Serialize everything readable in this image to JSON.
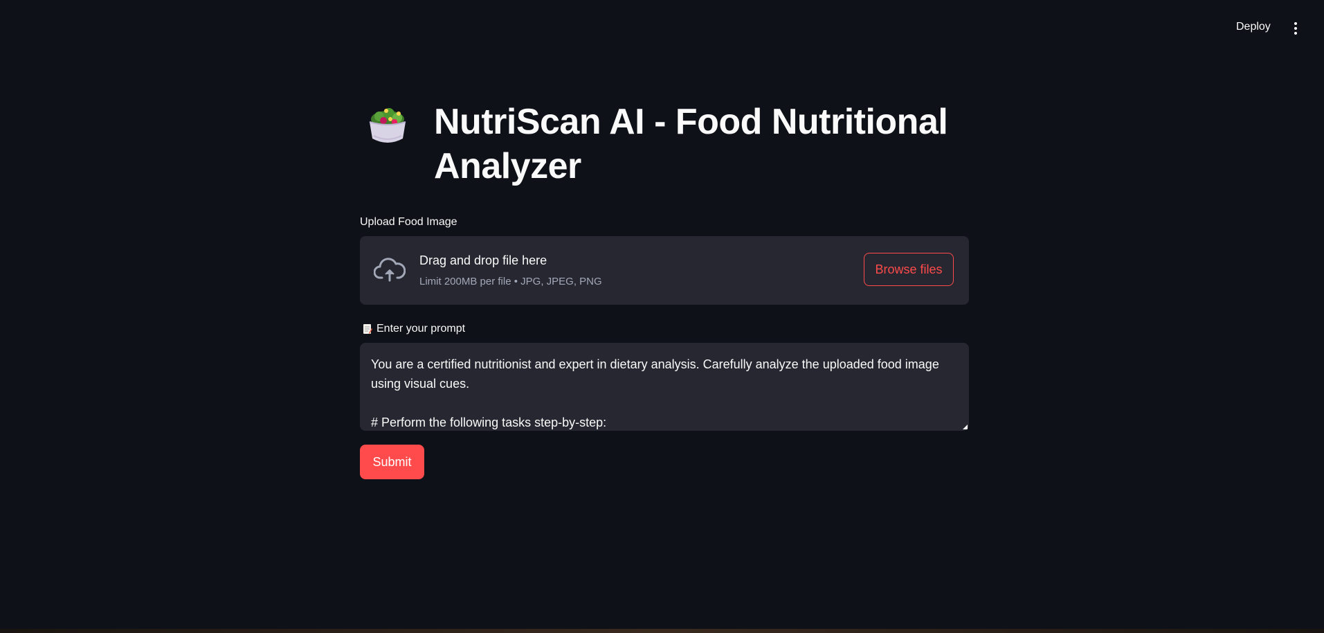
{
  "header": {
    "deploy_label": "Deploy",
    "menu_icon": "kebab-menu-icon"
  },
  "app": {
    "title_icon": "salad-bowl-icon",
    "title": "NutriScan AI - Food Nutritional Analyzer"
  },
  "uploader": {
    "label": "Upload Food Image",
    "icon": "cloud-upload-icon",
    "drop_text": "Drag and drop file here",
    "limit_text": "Limit 200MB per file • JPG, JPEG, PNG",
    "browse_label": "Browse files"
  },
  "prompt": {
    "icon": "memo-icon",
    "label": "Enter your prompt",
    "value": "You are a certified nutritionist and expert in dietary analysis. Carefully analyze the uploaded food image using visual cues.\n\n# Perform the following tasks step-by-step:"
  },
  "actions": {
    "submit_label": "Submit"
  },
  "colors": {
    "background": "#0e1117",
    "surface": "#262730",
    "accent": "#ff4b4b",
    "text": "#fafafa",
    "muted": "#a3a8b8"
  }
}
